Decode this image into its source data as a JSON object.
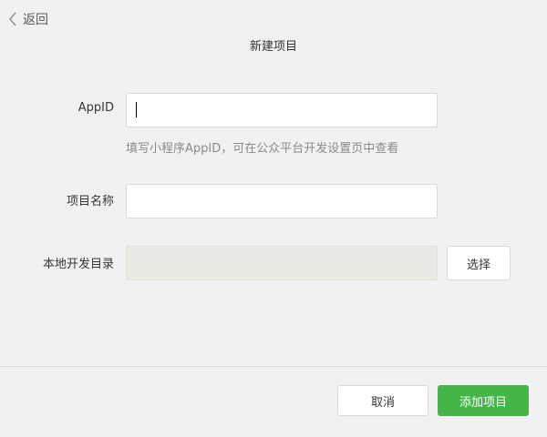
{
  "header": {
    "back_label": "返回",
    "title": "新建项目"
  },
  "form": {
    "appid": {
      "label": "AppID",
      "value": "",
      "hint": "填写小程序AppID，可在公众平台开发设置页中查看"
    },
    "project_name": {
      "label": "项目名称",
      "value": ""
    },
    "local_dir": {
      "label": "本地开发目录",
      "value": "",
      "choose_label": "选择"
    }
  },
  "footer": {
    "cancel_label": "取消",
    "submit_label": "添加项目"
  },
  "colors": {
    "primary": "#44b549",
    "background": "#f1f1f1",
    "disabled_input": "#eaeae5"
  },
  "icons": {
    "back": "chevron-left-icon"
  }
}
